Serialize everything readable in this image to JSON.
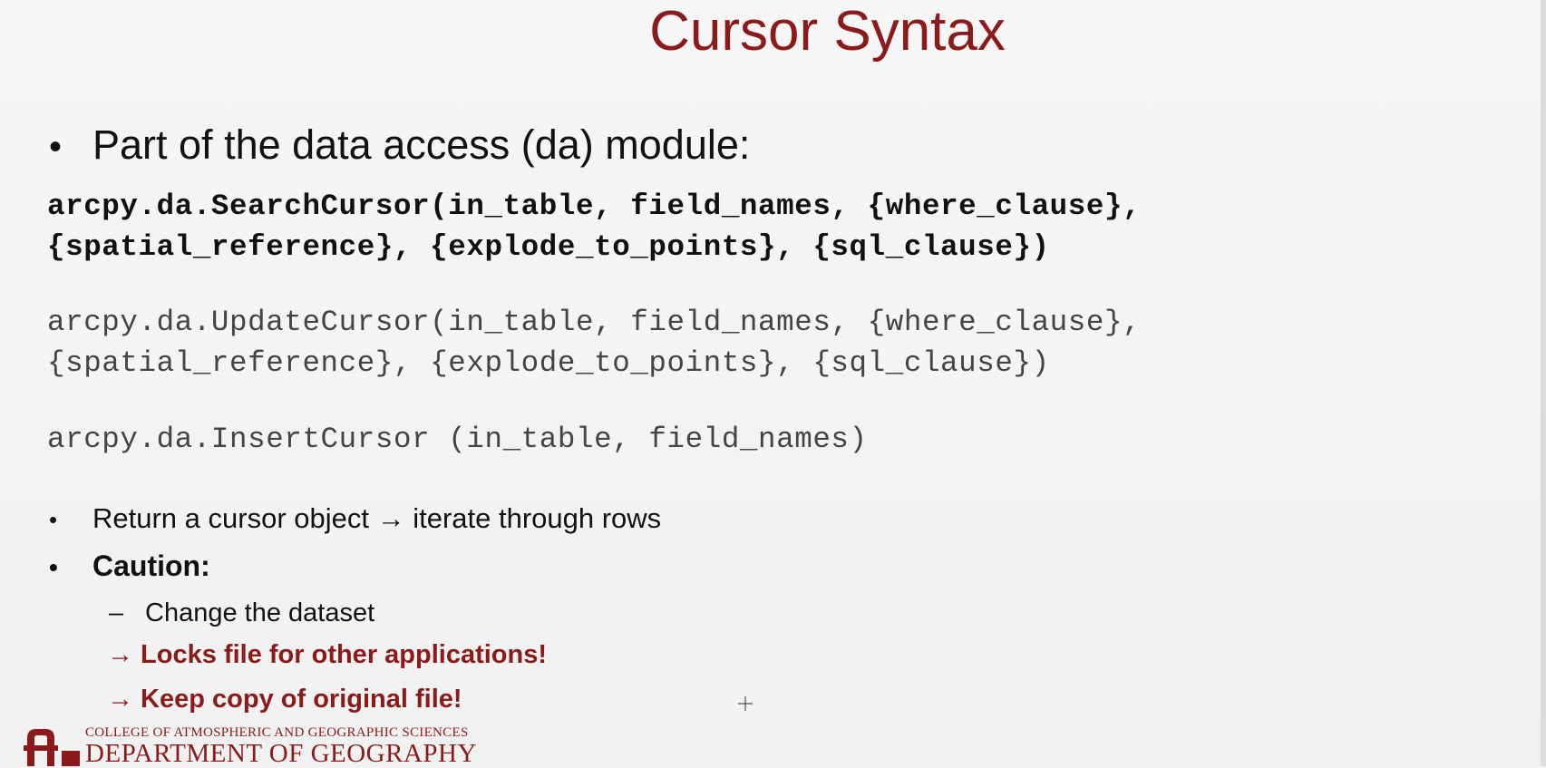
{
  "slide": {
    "title": "Cursor Syntax",
    "bullet_main": "Part of the data access (da) module:",
    "code_search": "arcpy.da.SearchCursor(in_table, field_names, {where_clause},\n{spatial_reference}, {explode_to_points}, {sql_clause})",
    "code_update_line1": "arcpy.da.UpdateCursor(in_table, field_names, {where_clause},",
    "code_update_line2": "{spatial_reference}, {explode_to_points}, {sql_clause})",
    "code_insert": "arcpy.da.InsertCursor (in_table, field_names)",
    "bullet_return": "Return a cursor object → iterate through rows",
    "bullet_caution": "Caution:",
    "sub_change": "Change the dataset",
    "warn_locks": "→ Locks file for other applications!",
    "warn_copy": "→ Keep copy of original file!",
    "bullet_symbol": "•",
    "dash_symbol": "–"
  },
  "footer": {
    "college": "COLLEGE OF ATMOSPHERIC AND GEOGRAPHIC SCIENCES",
    "department": "DEPARTMENT OF GEOGRAPHY"
  },
  "colors": {
    "title": "#8b1a1a",
    "warning": "#8b1a1a",
    "text": "#111111",
    "code_light": "#444444",
    "background": "#f3f3f3"
  },
  "icons": {
    "logo": "ou-logo-icon",
    "cursor": "crosshair-cursor-icon"
  }
}
